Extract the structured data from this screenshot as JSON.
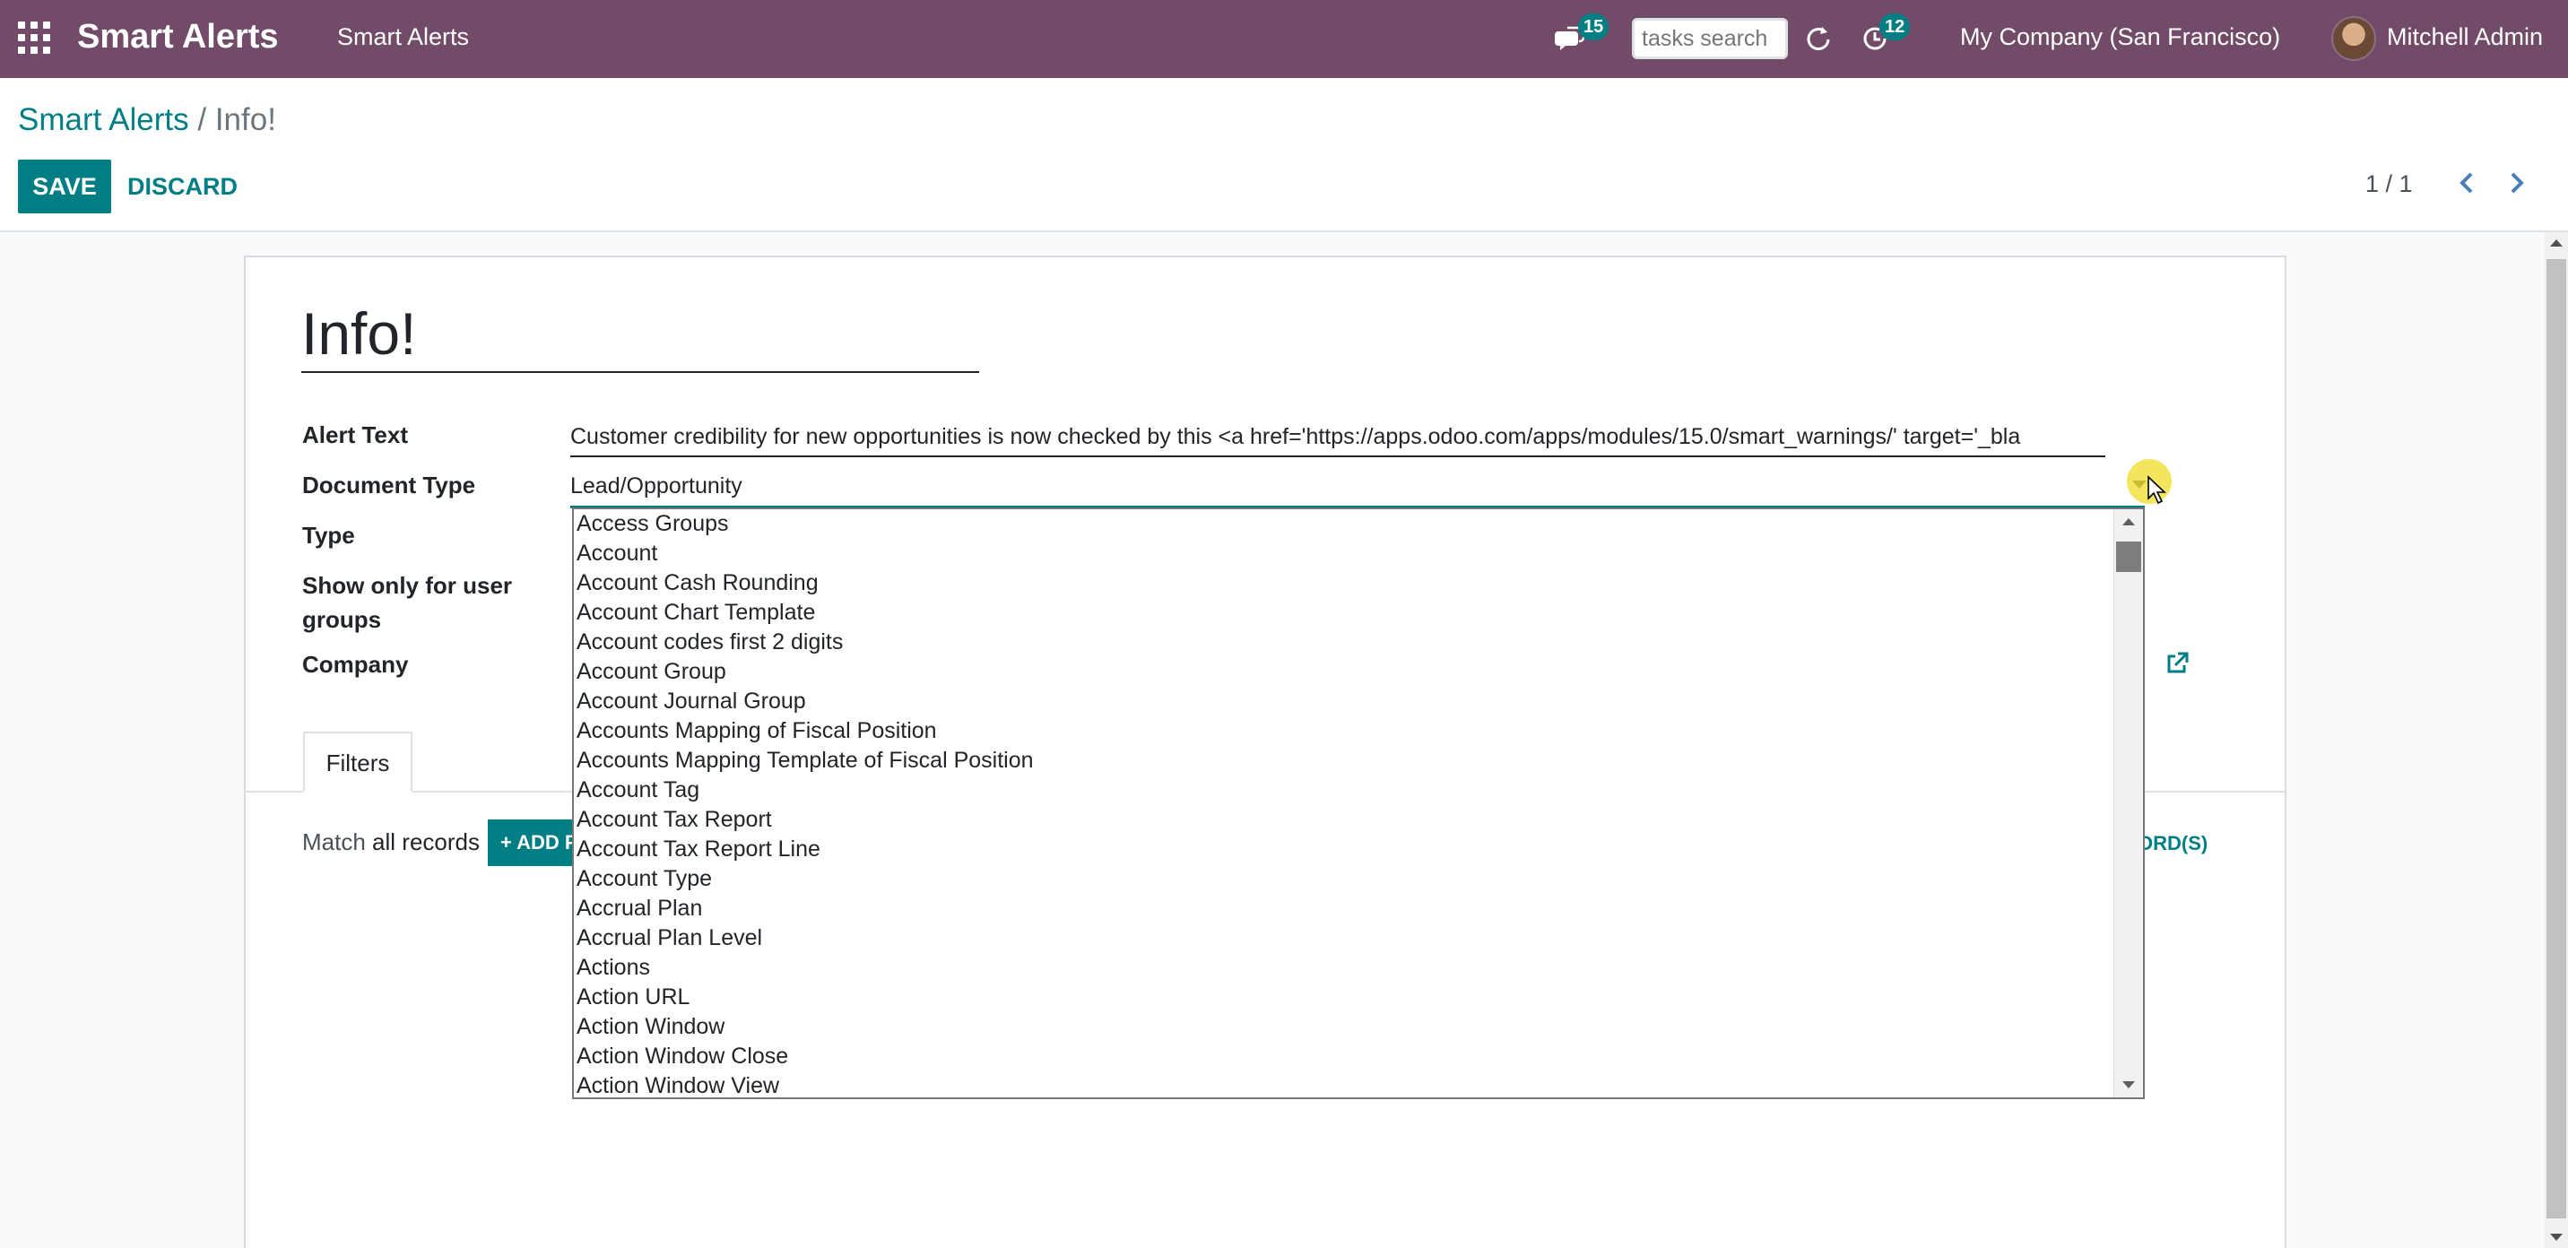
{
  "navbar": {
    "brand": "Smart Alerts",
    "menu_item": "Smart Alerts",
    "messages_count": "15",
    "search_placeholder": "tasks search",
    "activities_count": "12",
    "company": "My Company (San Francisco)",
    "user": "Mitchell Admin"
  },
  "breadcrumb": {
    "parent": "Smart Alerts",
    "separator": "/",
    "current": "Info!"
  },
  "buttons": {
    "save": "SAVE",
    "discard": "DISCARD"
  },
  "pager": {
    "value": "1 / 1"
  },
  "form": {
    "title": "Info!",
    "labels": {
      "alert_text": "Alert Text",
      "document_type": "Document Type",
      "type": "Type",
      "show_only_line1": "Show only for user",
      "show_only_line2": "groups",
      "company": "Company"
    },
    "alert_text_value": "Customer credibility for new opportunities is now checked by this <a href='https://apps.odoo.com/apps/modules/15.0/smart_warnings/'  target='_bla",
    "document_type_value": "Lead/Opportunity"
  },
  "dropdown": {
    "options": [
      "Access Groups",
      "Account",
      "Account Cash Rounding",
      "Account Chart Template",
      "Account codes first 2 digits",
      "Account Group",
      "Account Journal Group",
      "Accounts Mapping of Fiscal Position",
      "Accounts Mapping Template of Fiscal Position",
      "Account Tag",
      "Account Tax Report",
      "Account Tax Report Line",
      "Account Type",
      "Accrual Plan",
      "Accrual Plan Level",
      "Actions",
      "Action URL",
      "Action Window",
      "Action Window Close",
      "Action Window View"
    ]
  },
  "tabs": {
    "filters": "Filters"
  },
  "filters": {
    "match_prefix": "Match",
    "match_value": "all records",
    "add_button": "+ ADD FILTER",
    "records_link": "ORD(S)"
  },
  "colors": {
    "navbar": "#714B67",
    "accent": "#017E84"
  }
}
